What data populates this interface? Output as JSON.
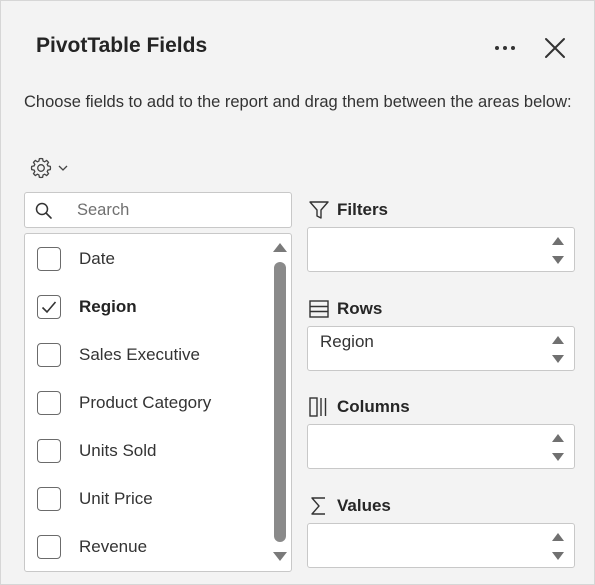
{
  "pane": {
    "title": "PivotTable Fields",
    "instructions": "Choose fields to add to the report and drag them between the areas below:"
  },
  "search": {
    "placeholder": "Search",
    "value": ""
  },
  "fields": [
    {
      "label": "Date",
      "checked": false
    },
    {
      "label": "Region",
      "checked": true
    },
    {
      "label": "Sales Executive",
      "checked": false
    },
    {
      "label": "Product Category",
      "checked": false
    },
    {
      "label": "Units Sold",
      "checked": false
    },
    {
      "label": "Unit Price",
      "checked": false
    },
    {
      "label": "Revenue",
      "checked": false
    }
  ],
  "areas": {
    "filters": {
      "label": "Filters",
      "items": []
    },
    "rows": {
      "label": "Rows",
      "items": [
        "Region"
      ]
    },
    "columns": {
      "label": "Columns",
      "items": []
    },
    "values": {
      "label": "Values",
      "items": []
    }
  },
  "icons": {
    "more": "more-icon",
    "close": "close-icon",
    "settings": "gear-icon",
    "search": "search-icon",
    "filters": "funnel-icon",
    "rows": "rows-icon",
    "columns": "columns-icon",
    "values": "sigma-icon"
  }
}
